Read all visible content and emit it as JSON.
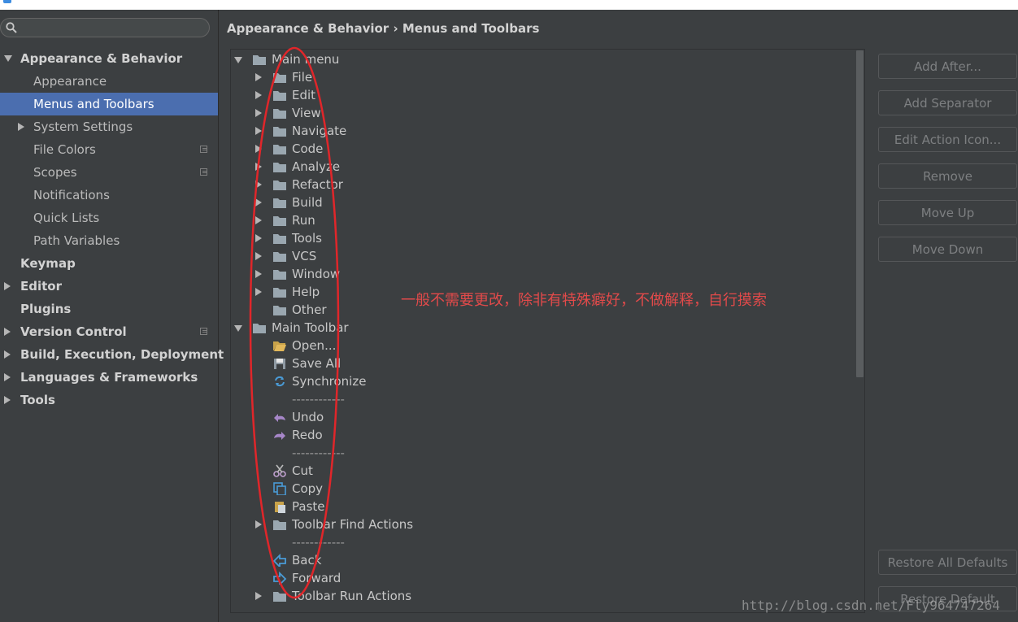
{
  "breadcrumb": {
    "section": "Appearance & Behavior",
    "separator": "›",
    "page": "Menus and Toolbars"
  },
  "search": {
    "value": "",
    "placeholder": ""
  },
  "sidebar": {
    "items": [
      {
        "label": "Appearance & Behavior",
        "level": 0,
        "bold": true,
        "expander": "expanded",
        "selected": false,
        "project_icon": false
      },
      {
        "label": "Appearance",
        "level": 1,
        "bold": false,
        "expander": "none",
        "selected": false,
        "project_icon": false
      },
      {
        "label": "Menus and Toolbars",
        "level": 1,
        "bold": false,
        "expander": "none",
        "selected": true,
        "project_icon": false
      },
      {
        "label": "System Settings",
        "level": 1,
        "bold": false,
        "expander": "collapsed",
        "selected": false,
        "project_icon": false
      },
      {
        "label": "File Colors",
        "level": 1,
        "bold": false,
        "expander": "none",
        "selected": false,
        "project_icon": true
      },
      {
        "label": "Scopes",
        "level": 1,
        "bold": false,
        "expander": "none",
        "selected": false,
        "project_icon": true
      },
      {
        "label": "Notifications",
        "level": 1,
        "bold": false,
        "expander": "none",
        "selected": false,
        "project_icon": false
      },
      {
        "label": "Quick Lists",
        "level": 1,
        "bold": false,
        "expander": "none",
        "selected": false,
        "project_icon": false
      },
      {
        "label": "Path Variables",
        "level": 1,
        "bold": false,
        "expander": "none",
        "selected": false,
        "project_icon": false
      },
      {
        "label": "Keymap",
        "level": 0,
        "bold": true,
        "expander": "none",
        "selected": false,
        "project_icon": false
      },
      {
        "label": "Editor",
        "level": 0,
        "bold": true,
        "expander": "collapsed",
        "selected": false,
        "project_icon": false
      },
      {
        "label": "Plugins",
        "level": 0,
        "bold": true,
        "expander": "none",
        "selected": false,
        "project_icon": false
      },
      {
        "label": "Version Control",
        "level": 0,
        "bold": true,
        "expander": "collapsed",
        "selected": false,
        "project_icon": true
      },
      {
        "label": "Build, Execution, Deployment",
        "level": 0,
        "bold": true,
        "expander": "collapsed",
        "selected": false,
        "project_icon": false
      },
      {
        "label": "Languages & Frameworks",
        "level": 0,
        "bold": true,
        "expander": "collapsed",
        "selected": false,
        "project_icon": false
      },
      {
        "label": "Tools",
        "level": 0,
        "bold": true,
        "expander": "collapsed",
        "selected": false,
        "project_icon": false
      }
    ]
  },
  "tree": {
    "rows": [
      {
        "label": "Main menu",
        "level": 0,
        "expander": "expanded",
        "icon": "folder-icon"
      },
      {
        "label": "File",
        "level": 1,
        "expander": "collapsed",
        "icon": "folder-icon"
      },
      {
        "label": "Edit",
        "level": 1,
        "expander": "collapsed",
        "icon": "folder-icon"
      },
      {
        "label": "View",
        "level": 1,
        "expander": "collapsed",
        "icon": "folder-icon"
      },
      {
        "label": "Navigate",
        "level": 1,
        "expander": "collapsed",
        "icon": "folder-icon"
      },
      {
        "label": "Code",
        "level": 1,
        "expander": "collapsed",
        "icon": "folder-icon"
      },
      {
        "label": "Analyze",
        "level": 1,
        "expander": "collapsed",
        "icon": "folder-icon"
      },
      {
        "label": "Refactor",
        "level": 1,
        "expander": "collapsed",
        "icon": "folder-icon"
      },
      {
        "label": "Build",
        "level": 1,
        "expander": "collapsed",
        "icon": "folder-icon"
      },
      {
        "label": "Run",
        "level": 1,
        "expander": "collapsed",
        "icon": "folder-icon"
      },
      {
        "label": "Tools",
        "level": 1,
        "expander": "collapsed",
        "icon": "folder-icon"
      },
      {
        "label": "VCS",
        "level": 1,
        "expander": "collapsed",
        "icon": "folder-icon"
      },
      {
        "label": "Window",
        "level": 1,
        "expander": "collapsed",
        "icon": "folder-icon"
      },
      {
        "label": "Help",
        "level": 1,
        "expander": "collapsed",
        "icon": "folder-icon"
      },
      {
        "label": "Other",
        "level": 1,
        "expander": "none",
        "icon": "folder-icon"
      },
      {
        "label": "Main Toolbar",
        "level": 0,
        "expander": "expanded",
        "icon": "folder-icon"
      },
      {
        "label": "Open...",
        "level": 1,
        "expander": "none",
        "icon": "open-folder-icon"
      },
      {
        "label": "Save All",
        "level": 1,
        "expander": "none",
        "icon": "save-icon"
      },
      {
        "label": "Synchronize",
        "level": 1,
        "expander": "none",
        "icon": "sync-icon"
      },
      {
        "label": "------------",
        "level": 1,
        "expander": "none",
        "icon": "none"
      },
      {
        "label": "Undo",
        "level": 1,
        "expander": "none",
        "icon": "undo-icon"
      },
      {
        "label": "Redo",
        "level": 1,
        "expander": "none",
        "icon": "redo-icon"
      },
      {
        "label": "------------",
        "level": 1,
        "expander": "none",
        "icon": "none"
      },
      {
        "label": "Cut",
        "level": 1,
        "expander": "none",
        "icon": "cut-icon"
      },
      {
        "label": "Copy",
        "level": 1,
        "expander": "none",
        "icon": "copy-icon"
      },
      {
        "label": "Paste",
        "level": 1,
        "expander": "none",
        "icon": "paste-icon"
      },
      {
        "label": "Toolbar Find Actions",
        "level": 1,
        "expander": "collapsed",
        "icon": "folder-icon"
      },
      {
        "label": "------------",
        "level": 1,
        "expander": "none",
        "icon": "none"
      },
      {
        "label": "Back",
        "level": 1,
        "expander": "none",
        "icon": "back-icon"
      },
      {
        "label": "Forward",
        "level": 1,
        "expander": "none",
        "icon": "forward-icon"
      },
      {
        "label": "Toolbar Run Actions",
        "level": 1,
        "expander": "collapsed",
        "icon": "folder-icon"
      }
    ]
  },
  "buttons": {
    "add_after": "Add After...",
    "add_separator": "Add Separator",
    "edit_action_icon": "Edit Action Icon...",
    "remove": "Remove",
    "move_up": "Move Up",
    "move_down": "Move Down",
    "restore_all_defaults": "Restore All Defaults",
    "restore_default": "Restore Default"
  },
  "annotation": "一般不需要更改，除非有特殊癖好，不做解释，自行摸索",
  "watermark": "http://blog.csdn.net/Fly964747264",
  "colors": {
    "background": "#3c3f41",
    "selection": "#4b6eaf",
    "folder": "#9aa7b0",
    "annotation_red": "#e24a4a"
  }
}
